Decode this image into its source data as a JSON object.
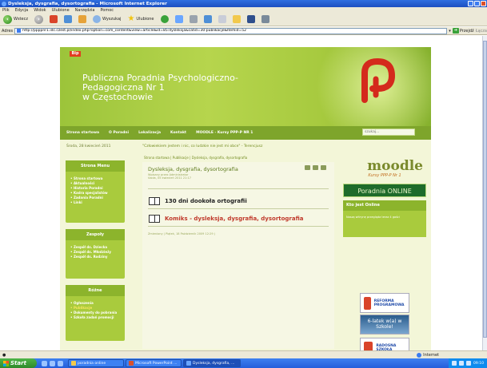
{
  "window": {
    "title": "Dysleksja, dysgrafia, dysortografia - Microsoft Internet Explorer"
  },
  "menu": [
    "Plik",
    "Edycja",
    "Widok",
    "Ulubione",
    "Narzędzia",
    "Pomoc"
  ],
  "toolbar": {
    "back_label": "Wstecz",
    "search_label": "Wyszukaj",
    "favorites_label": "Ulubione"
  },
  "address": {
    "label": "Adres",
    "url": "http://ppppnr1.idc.czest.pl/index.php?option=com_content&view=article&id=85:dysleksja&catid=30:publikacje&Itemid=52",
    "go_label": "Przejdź",
    "links_label": "Łącza"
  },
  "site": {
    "logo_text": "Bip",
    "title_lines": [
      "Publiczna Poradnia Psychologiczno-",
      "Pedagogiczna Nr 1",
      "w Częstochowie"
    ]
  },
  "nav": [
    "Strona startowa",
    "O Poradni",
    "Lokalizacja",
    "Kontakt",
    "MOODLE - Kursy PPP-P NR 1"
  ],
  "search": {
    "placeholder": "szukaj..."
  },
  "date": "Środa, 28 kwiecień 2011",
  "quote": "\"Człowiekiem jestem i nic, co ludzkie nie jest mi obce\" - Terencjusz",
  "sidebar": {
    "menu": {
      "title": "Strona Menu",
      "items": [
        "Strona startowa",
        "Aktualności",
        "Historia Poradni",
        "Kadra specjalistów",
        "Zadania Poradni",
        "Linki"
      ]
    },
    "zespoly": {
      "title": "Zespoły",
      "items": [
        "Zespół ds. Dziecka",
        "Zespół ds. Młodzieży",
        "Zespół ds. Rodziny"
      ]
    },
    "rozne": {
      "title": "Różne",
      "items": [
        "Ogłoszenia",
        "Publikacje",
        "Dokumenty do pobrania",
        "Szkoła zadań promocji"
      ],
      "active_index": 1
    }
  },
  "breadcrumb": "Strona startowa  |  Publikacje  |  Dysleksja, dysgrafia, dysortografia",
  "article": {
    "title": "Dysleksja, dysgrafia, dysortografia",
    "meta_author": "Wpisany przez Administrator",
    "meta_date": "środa, 05 kwiecień 2011 21:17",
    "entries": [
      "130 dni dookoła ortografii",
      "Komiks - dysleksja, dysgrafia, dysortografia"
    ],
    "updated": "Zmieniony ( Piątek, 18 Październik 2009 12:29 )"
  },
  "right": {
    "moodle_word": "moodle",
    "moodle_sub": "Kursy PPP-P Nr 1",
    "online_banner": "Poradnia ONLINE",
    "who_online_title": "Kto jest Online",
    "who_online_body": "Naszą witrynę przegląda teraz 4 gości",
    "promos": [
      "REFORMA PROGRAMOWA",
      "6-latek w(a) w Szkole!",
      "RADOSNA SZKOŁA"
    ]
  },
  "status": {
    "zone_label": "Internet"
  },
  "taskbar": {
    "start_label": "Start",
    "tasks": [
      "poradnia online",
      "Microsoft PowerPoint ...",
      "Dysleksja, dysgrafia, ..."
    ],
    "tray_time": "09:10"
  }
}
